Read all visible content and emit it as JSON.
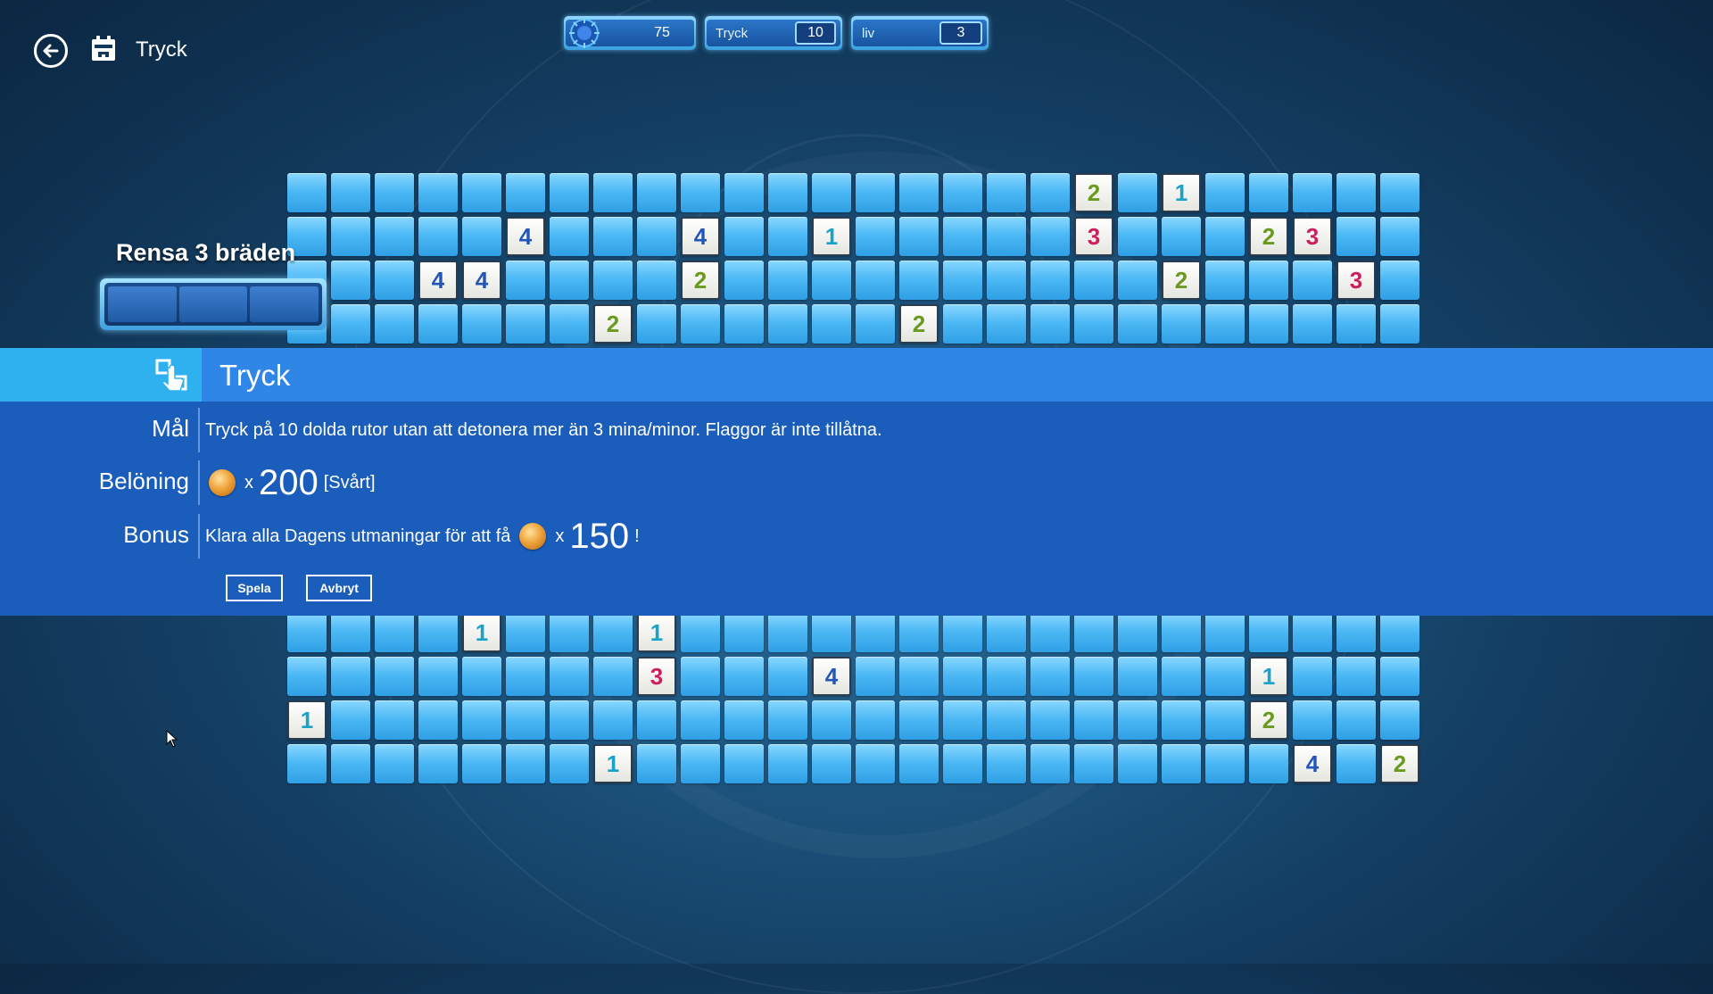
{
  "header": {
    "title": "Tryck"
  },
  "stats": {
    "score": "75",
    "tap_label": "Tryck",
    "tap_value": "10",
    "lives_label": "liv",
    "lives_value": "3"
  },
  "progress": {
    "title": "Rensa 3 bräden",
    "boards_total": 3,
    "boards_done": 0
  },
  "board_top": [
    {
      "r": 0,
      "c": 18,
      "n": "2"
    },
    {
      "r": 0,
      "c": 20,
      "n": "1"
    },
    {
      "r": 1,
      "c": 5,
      "n": "4"
    },
    {
      "r": 1,
      "c": 9,
      "n": "4"
    },
    {
      "r": 1,
      "c": 12,
      "n": "1"
    },
    {
      "r": 1,
      "c": 18,
      "n": "3"
    },
    {
      "r": 1,
      "c": 22,
      "n": "2"
    },
    {
      "r": 1,
      "c": 23,
      "n": "3"
    },
    {
      "r": 2,
      "c": 3,
      "n": "4"
    },
    {
      "r": 2,
      "c": 4,
      "n": "4"
    },
    {
      "r": 2,
      "c": 9,
      "n": "2"
    },
    {
      "r": 2,
      "c": 20,
      "n": "2"
    },
    {
      "r": 2,
      "c": 24,
      "n": "3"
    },
    {
      "r": 3,
      "c": 7,
      "n": "2"
    },
    {
      "r": 3,
      "c": 14,
      "n": "2"
    }
  ],
  "board_bottom": [
    {
      "r": 0,
      "c": 4,
      "n": "1"
    },
    {
      "r": 0,
      "c": 8,
      "n": "1"
    },
    {
      "r": 1,
      "c": 8,
      "n": "3"
    },
    {
      "r": 1,
      "c": 12,
      "n": "4"
    },
    {
      "r": 1,
      "c": 22,
      "n": "1"
    },
    {
      "r": 2,
      "c": 0,
      "n": "1"
    },
    {
      "r": 2,
      "c": 22,
      "n": "2"
    },
    {
      "r": 3,
      "c": 7,
      "n": "1"
    },
    {
      "r": 3,
      "c": 23,
      "n": "4"
    },
    {
      "r": 3,
      "c": 25,
      "n": "2"
    }
  ],
  "number_colors": {
    "1": "#1aa3c8",
    "2": "#6a9a1f",
    "3": "#cc1f5f",
    "4": "#2456b8"
  },
  "challenge": {
    "title": "Tryck",
    "goal_label": "Mål",
    "goal_text": "Tryck på 10 dolda rutor utan att detonera mer än 3 mina/minor. Flaggor är inte tillåtna.",
    "reward_label": "Belöning",
    "reward_mult": "x",
    "reward_amount": "200",
    "reward_difficulty": "[Svårt]",
    "bonus_label": "Bonus",
    "bonus_text": "Klara alla Dagens utmaningar för att få",
    "bonus_mult": "x",
    "bonus_amount": "150",
    "bonus_suffix": "!",
    "play_button": "Spela",
    "cancel_button": "Avbryt"
  },
  "colors": {
    "header_bar": "#2f86e6",
    "icon_box": "#2fb0ef",
    "panel_body": "#1a5dbb"
  }
}
